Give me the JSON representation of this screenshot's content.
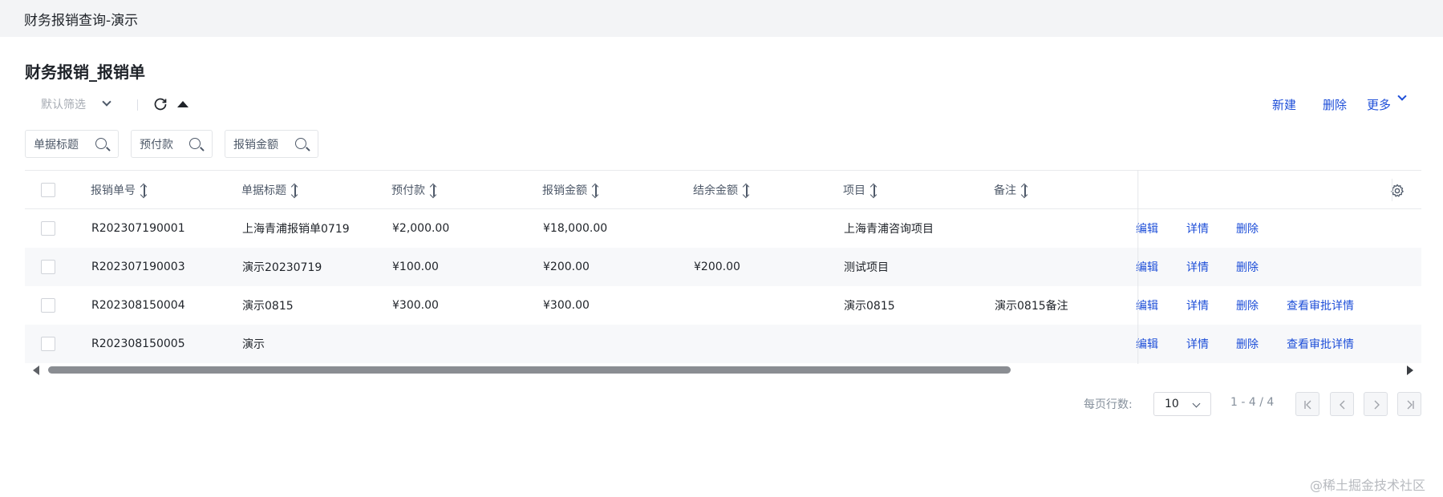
{
  "window_title": "财务报销查询-演示",
  "card_title": "财务报销_报销单",
  "filter_select": {
    "value": "默认筛选"
  },
  "toolbar": {
    "new_label": "新建",
    "delete_label": "删除",
    "more_label": "更多"
  },
  "search_fields": [
    "单据标题",
    "预付款",
    "报销金额"
  ],
  "columns": [
    "报销单号",
    "单据标题",
    "预付款",
    "报销金额",
    "结余金额",
    "项目",
    "备注"
  ],
  "rows": [
    {
      "no": "R202307190001",
      "title": "上海青浦报销单0719",
      "prepay": "¥2,000.00",
      "amount": "¥18,000.00",
      "balance": "",
      "project": "上海青浦咨询项目",
      "remark": "",
      "ops": [
        "编辑",
        "详情",
        "删除"
      ]
    },
    {
      "no": "R202307190003",
      "title": "演示20230719",
      "prepay": "¥100.00",
      "amount": "¥200.00",
      "balance": "¥200.00",
      "project": "测试项目",
      "remark": "",
      "ops": [
        "编辑",
        "详情",
        "删除"
      ]
    },
    {
      "no": "R202308150004",
      "title": "演示0815",
      "prepay": "¥300.00",
      "amount": "¥300.00",
      "balance": "",
      "project": "演示0815",
      "remark": "演示0815备注",
      "ops": [
        "编辑",
        "详情",
        "删除",
        "查看审批详情"
      ]
    },
    {
      "no": "R202308150005",
      "title": "演示",
      "prepay": "",
      "amount": "",
      "balance": "",
      "project": "",
      "remark": "",
      "ops": [
        "编辑",
        "详情",
        "删除",
        "查看审批详情"
      ]
    }
  ],
  "pagination": {
    "rows_per_page_label": "每页行数:",
    "page_size": "10",
    "range": "1 - 4 / 4"
  },
  "watermark": "@稀土掘金技术社区",
  "colors": {
    "link": "#1d4ed8",
    "topbar_bg": "#f3f4f6",
    "alt_row": "#f7f8fa"
  }
}
